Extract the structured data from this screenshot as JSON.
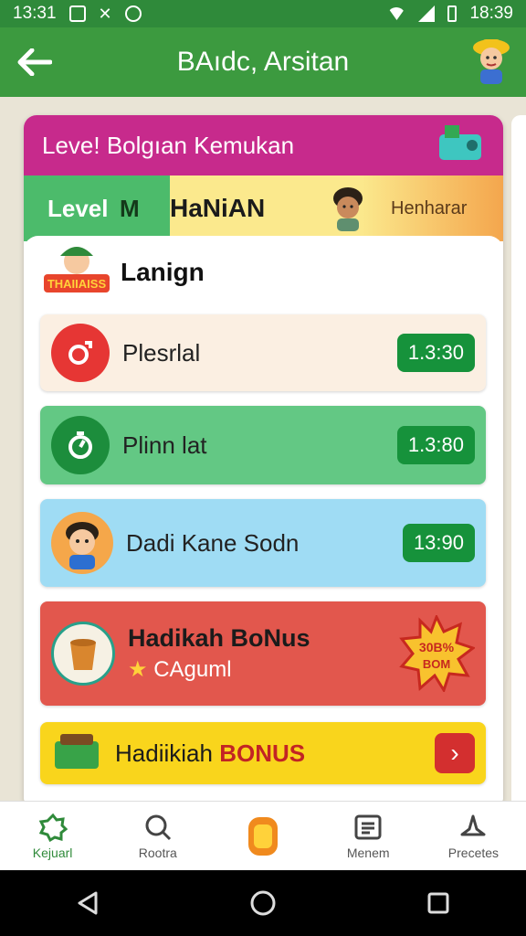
{
  "status_bar": {
    "time_left": "13:31",
    "time_right": "18:39"
  },
  "app_bar": {
    "title": "BAıdc, Arsitan"
  },
  "card": {
    "header_title": "Leve! Bolgıan Kemukan",
    "level_label": "Level",
    "level_value": "M",
    "level_name": "HaNiAN",
    "level_right": "Henharar"
  },
  "panel": {
    "title": "Lanign",
    "logo_text": "THAIIAISS"
  },
  "rows": [
    {
      "label": "Plesrlal",
      "value": "1.3:30"
    },
    {
      "label": "Plinn lat",
      "value": "1.3:80"
    },
    {
      "label": "Dadi Kane Sodn",
      "value": "13:90"
    }
  ],
  "bonus_card": {
    "title": "Hadikah BoNus",
    "subtitle": "CAguml",
    "burst_line1": "30B%",
    "burst_line2": "BOM"
  },
  "bonus_bar": {
    "label_plain": "Hadiikiah",
    "label_bold": "BONUS"
  },
  "bottom_nav": [
    {
      "label": "Kejuarl",
      "icon": "star-badge-icon"
    },
    {
      "label": "Rootra",
      "icon": "search-icon"
    },
    {
      "label": "",
      "icon": "coin-icon"
    },
    {
      "label": "Menem",
      "icon": "menu-list-icon"
    },
    {
      "label": "Precetes",
      "icon": "profile-icon"
    }
  ],
  "colors": {
    "status_bar": "#2f8a3a",
    "app_bar": "#3c9a3f",
    "card_header": "#c72a8c",
    "row_pill": "#16923b",
    "bonus_red": "#e2574d",
    "bonus_yellow": "#f9d51c"
  }
}
